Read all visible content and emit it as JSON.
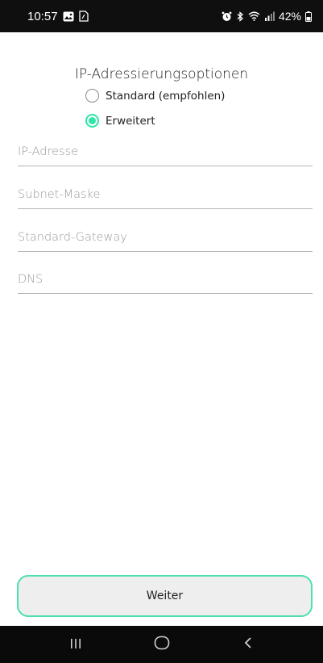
{
  "status_bar": {
    "time": "10:57",
    "notification_icons": [
      "image-icon",
      "sim-icon"
    ],
    "battery": "42%",
    "system_icons": [
      "alarm-icon",
      "bluetooth-icon",
      "wifi-icon",
      "signal-icon",
      "battery-icon"
    ]
  },
  "section": {
    "title": "IP-Adressierungsoptionen"
  },
  "options": [
    {
      "label": "Standard (empfohlen)",
      "checked": false
    },
    {
      "label": "Erweitert",
      "checked": true
    }
  ],
  "fields": [
    {
      "placeholder": "IP-Adresse",
      "value": ""
    },
    {
      "placeholder": "Subnet-Maske",
      "value": ""
    },
    {
      "placeholder": "Standard-Gateway",
      "value": ""
    },
    {
      "placeholder": "DNS",
      "value": ""
    }
  ],
  "button": {
    "label": "Weiter"
  },
  "nav": {
    "icons": [
      "recent-apps-icon",
      "home-icon",
      "back-icon"
    ]
  },
  "colors": {
    "accent": "#2ee6a8",
    "button_border": "#4ee0ac",
    "button_bg": "#eeeeee",
    "system_bar": "#0f0f0f"
  }
}
